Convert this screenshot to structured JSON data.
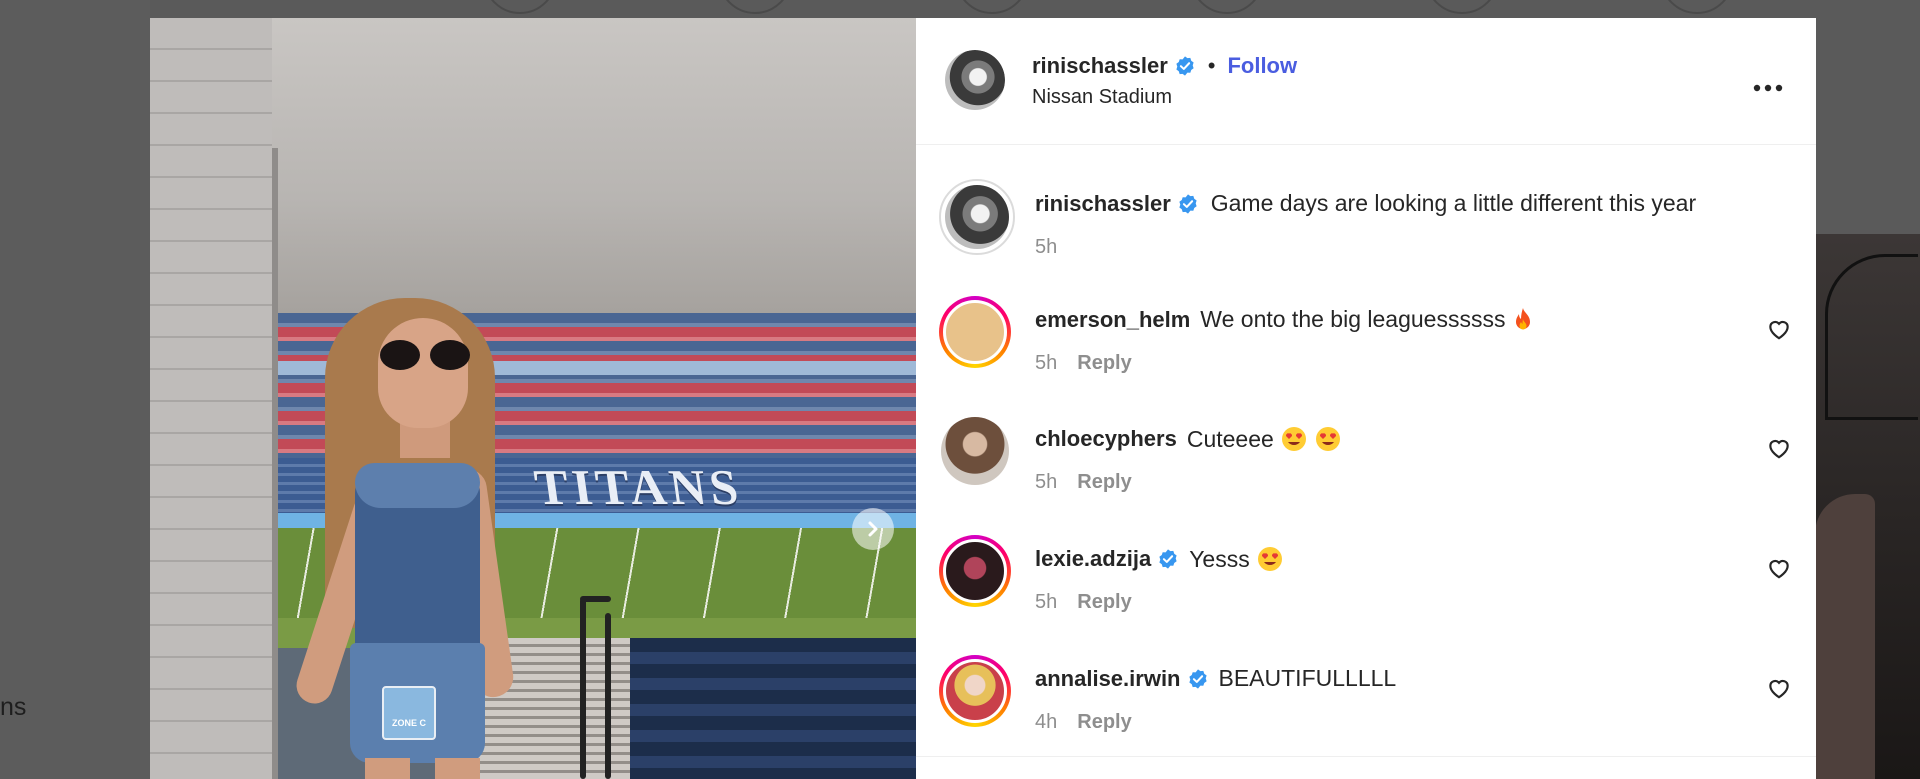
{
  "backdrop": {
    "left_text": "ns"
  },
  "post": {
    "author": "rinischassler",
    "follow_label": "Follow",
    "location": "Nissan Stadium",
    "caption": "Game days are looking a little different this year",
    "caption_time": "5h",
    "image": {
      "titans_text": "TITANS",
      "badge_text": "ZONE C"
    }
  },
  "comments": [
    {
      "username": "emerson_helm",
      "verified": false,
      "text": "We onto the big leaguessssss",
      "emoji": [
        "fire-emoji"
      ],
      "time": "5h",
      "reply_label": "Reply",
      "avatar_style": "ring",
      "avatar_color": "#e8c28a"
    },
    {
      "username": "chloecyphers",
      "verified": false,
      "text": "Cuteeee",
      "emoji": [
        "heart-eyes-emoji",
        "heart-eyes-emoji"
      ],
      "time": "5h",
      "reply_label": "Reply",
      "avatar_style": "plain",
      "avatar_color": "#8a6b55"
    },
    {
      "username": "lexie.adzija",
      "verified": true,
      "text": "Yesss",
      "emoji": [
        "heart-eyes-emoji"
      ],
      "time": "5h",
      "reply_label": "Reply",
      "avatar_style": "ring",
      "avatar_color": "#3a1f22"
    },
    {
      "username": "annalise.irwin",
      "verified": true,
      "text": "BEAUTIFULLLLL",
      "emoji": [],
      "time": "4h",
      "reply_label": "Reply",
      "avatar_style": "ring",
      "avatar_color": "#c9404a"
    }
  ],
  "colors": {
    "follow": "#4a5de0",
    "verified": "#3897f0",
    "muted_text": "#8e8e8e"
  }
}
